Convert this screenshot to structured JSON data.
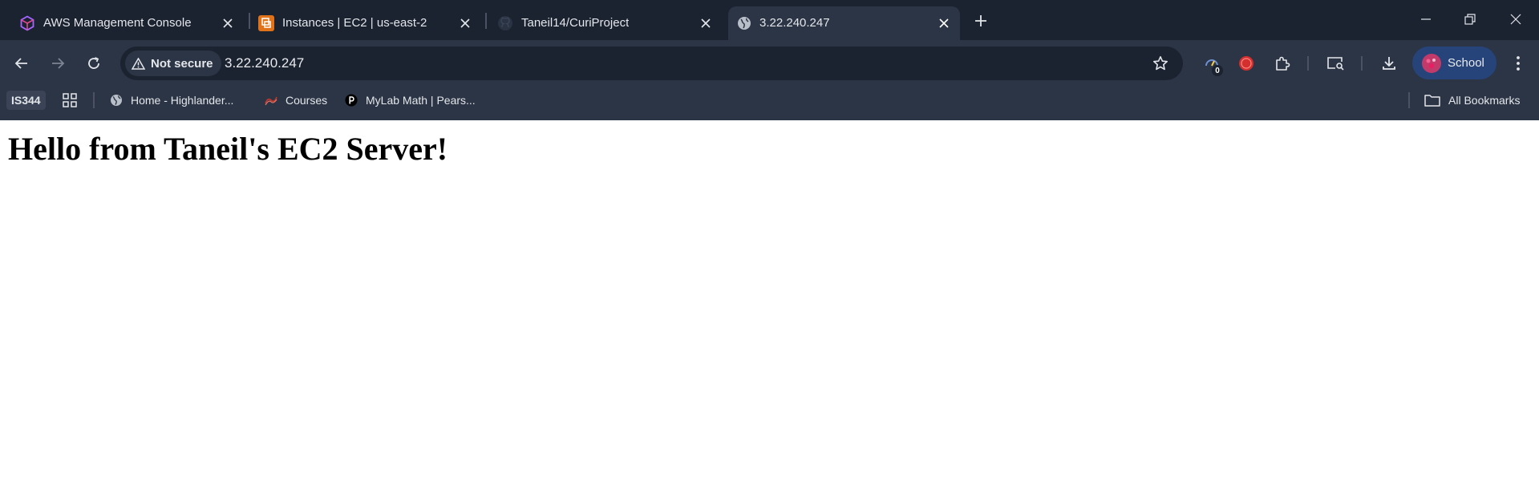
{
  "tabs": [
    {
      "title": "AWS Management Console",
      "icon": "aws-cube-icon",
      "active": false
    },
    {
      "title": "Instances | EC2 | us-east-2",
      "icon": "ec2-icon",
      "active": false
    },
    {
      "title": "Taneil14/CuriProject",
      "icon": "github-icon",
      "active": false
    },
    {
      "title": "3.22.240.247",
      "icon": "globe-icon",
      "active": true
    }
  ],
  "toolbar": {
    "security_label": "Not secure",
    "url": "3.22.240.247",
    "extension_badge": "0",
    "profile_label": "School"
  },
  "bookmarks": {
    "items": [
      {
        "label": "IS344",
        "icon": ""
      },
      {
        "label": "Home - Highlander...",
        "icon": "globe-icon"
      },
      {
        "label": "Courses",
        "icon": "courses-icon"
      },
      {
        "label": "MyLab Math | Pears...",
        "icon": "pearson-icon"
      }
    ],
    "all_bookmarks_label": "All Bookmarks"
  },
  "page": {
    "heading": "Hello from Taneil's EC2 Server!"
  },
  "colors": {
    "tabstrip": "#1b2230",
    "toolbar": "#2c3545",
    "profile_chip": "#27447a",
    "page_background": "#ffffff"
  }
}
